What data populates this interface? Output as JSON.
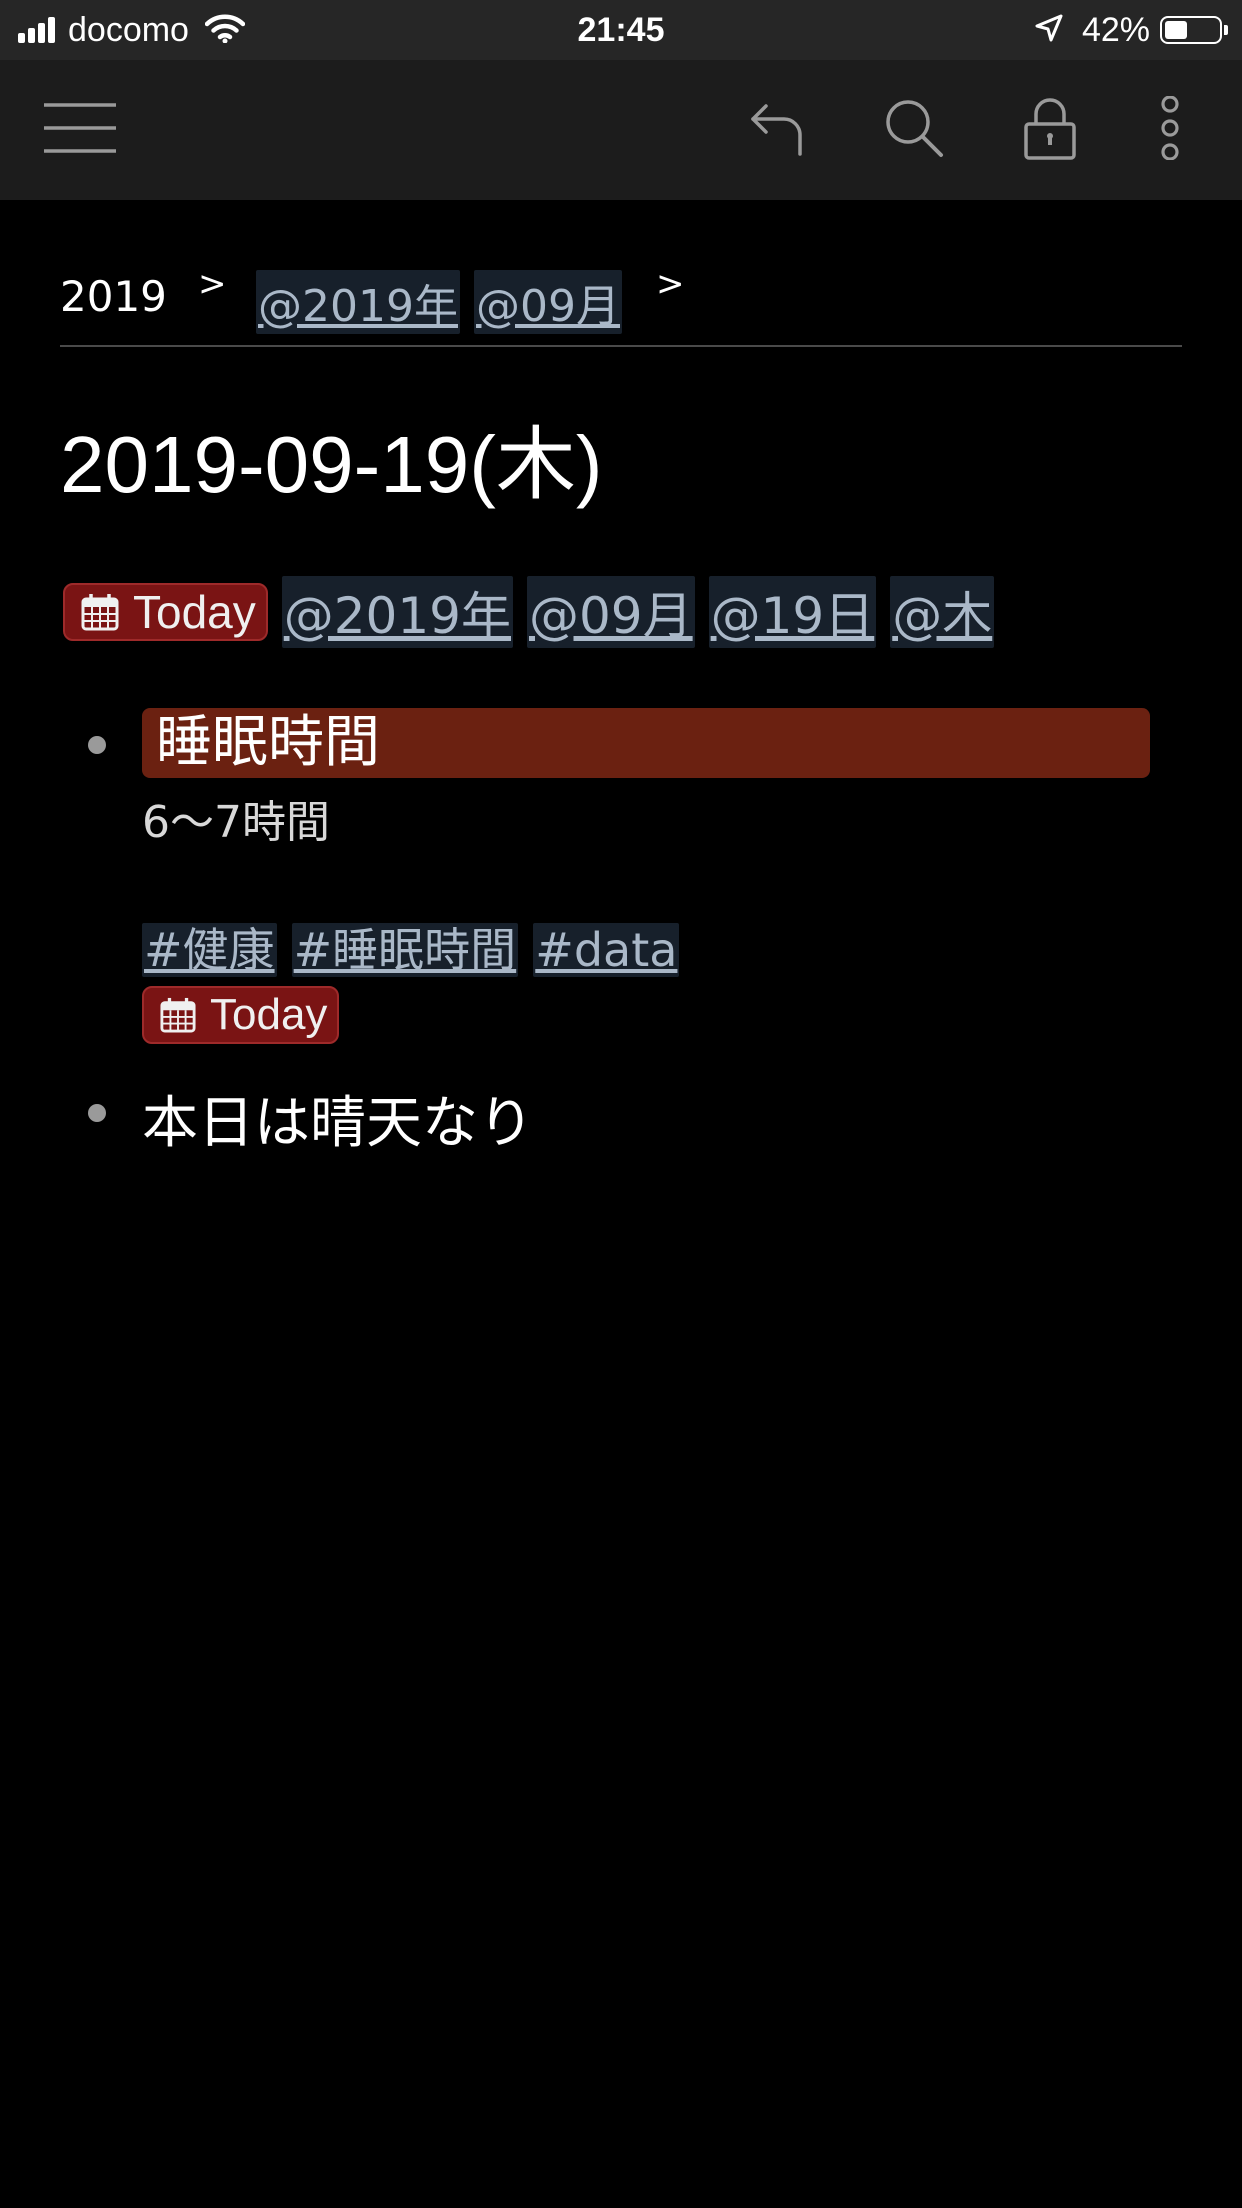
{
  "status_bar": {
    "carrier": "docomo",
    "time": "21:45",
    "battery_percent": "42%",
    "battery_level": 0.42
  },
  "toolbar": {
    "icons": [
      "menu-icon",
      "undo-icon",
      "search-icon",
      "lock-icon",
      "more-vertical-icon"
    ]
  },
  "breadcrumb": {
    "root": "2019",
    "separator": ">",
    "links": [
      "@2019年",
      "@09月"
    ]
  },
  "page": {
    "title": "2019-09-19(木)",
    "today_label": "Today",
    "tags": [
      "@2019年",
      "@09月",
      "@19日",
      "@木"
    ]
  },
  "bullets": [
    {
      "heading": "睡眠時間",
      "note": "6〜7時間",
      "tags": [
        "#健康",
        "#睡眠時間",
        "#data"
      ],
      "today_label": "Today"
    },
    {
      "text": "本日は晴天なり"
    }
  ],
  "colors": {
    "background": "#000000",
    "toolbar": "#1c1c1c",
    "statusbar": "#262626",
    "link": "#aab8c8",
    "today_badge": "#7a1414",
    "heading_highlight": "#6b2111"
  }
}
